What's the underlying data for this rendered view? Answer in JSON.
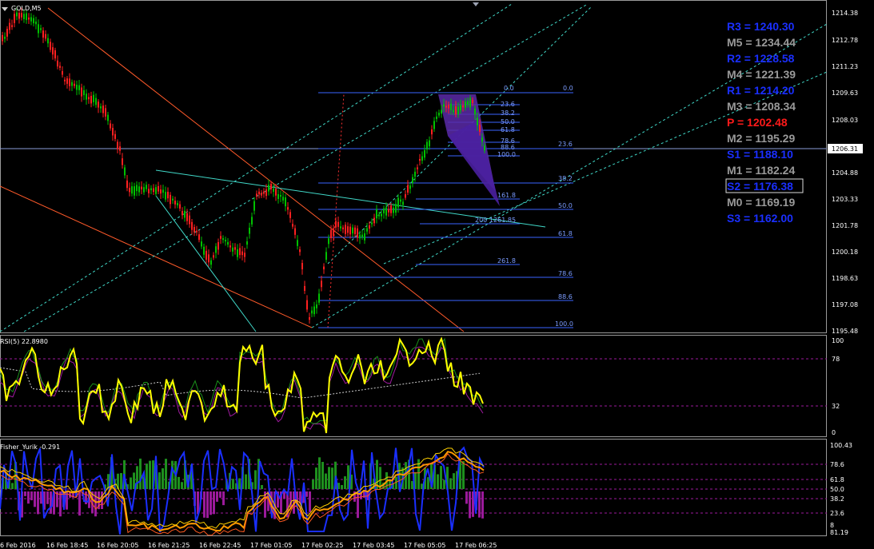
{
  "window": {
    "symbol_label": "GOLD,M5",
    "price_marker": "1206.31"
  },
  "price_axis": [
    "1214.38",
    "1212.78",
    "1211.23",
    "1209.63",
    "1208.03",
    "1206.31",
    "1204.88",
    "1203.33",
    "1201.78",
    "1200.18",
    "1198.63",
    "1197.08",
    "1195.48"
  ],
  "pivots": [
    {
      "text": "R3 = 1240.30",
      "color": "#1a2fff",
      "boxed": false
    },
    {
      "text": "M5 = 1234.44",
      "color": "#9a9a9a",
      "boxed": false
    },
    {
      "text": "R2 = 1228.58",
      "color": "#1a2fff",
      "boxed": false
    },
    {
      "text": "M4 = 1221.39",
      "color": "#9a9a9a",
      "boxed": false
    },
    {
      "text": "R1 = 1214.20",
      "color": "#1a2fff",
      "boxed": false
    },
    {
      "text": "M3 = 1208.34",
      "color": "#9a9a9a",
      "boxed": false
    },
    {
      "text": "P   = 1202.48",
      "color": "#ff1a1a",
      "boxed": false
    },
    {
      "text": "M2 = 1195.29",
      "color": "#9a9a9a",
      "boxed": false
    },
    {
      "text": "S1 = 1188.10",
      "color": "#1a2fff",
      "boxed": false
    },
    {
      "text": "M1 = 1182.24",
      "color": "#9a9a9a",
      "boxed": false
    },
    {
      "text": "S2 = 1176.38",
      "color": "#1a2fff",
      "boxed": true
    },
    {
      "text": "M0 = 1169.19",
      "color": "#9a9a9a",
      "boxed": false
    },
    {
      "text": "S3 = 1162.00",
      "color": "#1a2fff",
      "boxed": false
    }
  ],
  "fib_left": [
    "0.0",
    "23.6",
    "38.2",
    "50.0",
    "61.8",
    "78.6",
    "88.6",
    "100.0"
  ],
  "fib_right": [
    "0.0",
    "23.6",
    "38.2",
    "50.0",
    "61.8",
    "78.6",
    "88.6",
    "100.0"
  ],
  "fib_ext": [
    "161.8",
    "200",
    "1261.85",
    "261.8"
  ],
  "rsi": {
    "title": "RSI(5) 22.8980",
    "axis": [
      "100",
      "78",
      "32",
      "0"
    ]
  },
  "fisher": {
    "title": "Fisher_Yurik -0.291",
    "axis": [
      "100.43",
      "78.6",
      "61.8",
      "50.0",
      "38.2",
      "23.6",
      "8",
      "81.19"
    ]
  },
  "time_axis": [
    "6 Feb 2016",
    "16 Feb 18:45",
    "16 Feb 20:05",
    "16 Feb 21:25",
    "16 Feb 22:45",
    "17 Feb 01:05",
    "17 Feb 02:25",
    "17 Feb 03:45",
    "17 Feb 05:05",
    "17 Feb 06:25"
  ],
  "colors": {
    "bull": "#00c000",
    "bear": "#ff2020",
    "fisher_green": "#1e8f1e",
    "fisher_purple": "#9b1a9b",
    "rsi": "#ffff00",
    "blue": "#2020ff",
    "fib": "#4a78ff"
  }
}
